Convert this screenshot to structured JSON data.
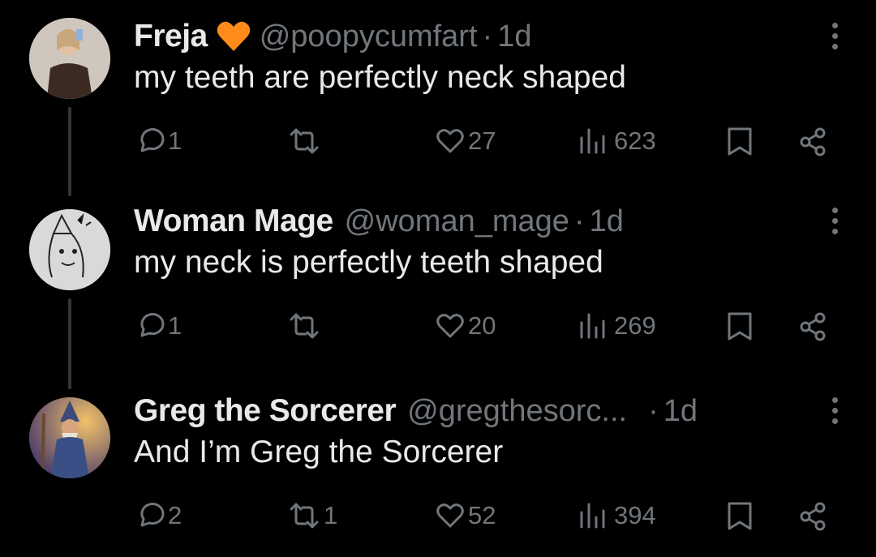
{
  "tweets": [
    {
      "name": "Freja",
      "handle": "@poopycumfart",
      "dot": "·",
      "time": "1d",
      "text": "my teeth are perfectly neck shaped",
      "emoji": "orange-heart",
      "replies": "1",
      "retweets": "",
      "likes": "27",
      "views": "623"
    },
    {
      "name": "Woman Mage",
      "handle": "@woman_mage",
      "dot": "·",
      "time": "1d",
      "text": "my neck is perfectly teeth shaped",
      "replies": "1",
      "retweets": "",
      "likes": "20",
      "views": "269"
    },
    {
      "name": "Greg the Sorcerer",
      "handle": "@gregthesorc...",
      "dot": "·",
      "time": "1d",
      "text": "And I’m Greg the Sorcerer",
      "replies": "2",
      "retweets": "1",
      "likes": "52",
      "views": "394"
    }
  ],
  "colors": {
    "background": "#000000",
    "text": "#e7e9ea",
    "muted": "#71767b",
    "heart": "#ff8c1a"
  }
}
